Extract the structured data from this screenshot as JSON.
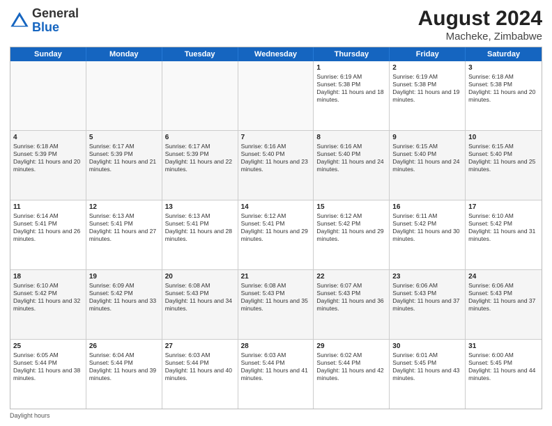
{
  "header": {
    "logo": {
      "general": "General",
      "blue": "Blue"
    },
    "title": "August 2024",
    "location": "Macheke, Zimbabwe"
  },
  "days_of_week": [
    "Sunday",
    "Monday",
    "Tuesday",
    "Wednesday",
    "Thursday",
    "Friday",
    "Saturday"
  ],
  "rows": [
    [
      {
        "day": "",
        "empty": true
      },
      {
        "day": "",
        "empty": true
      },
      {
        "day": "",
        "empty": true
      },
      {
        "day": "",
        "empty": true
      },
      {
        "day": "1",
        "sunrise": "6:19 AM",
        "sunset": "5:38 PM",
        "daylight": "11 hours and 18 minutes."
      },
      {
        "day": "2",
        "sunrise": "6:19 AM",
        "sunset": "5:38 PM",
        "daylight": "11 hours and 19 minutes."
      },
      {
        "day": "3",
        "sunrise": "6:18 AM",
        "sunset": "5:38 PM",
        "daylight": "11 hours and 20 minutes."
      }
    ],
    [
      {
        "day": "4",
        "sunrise": "6:18 AM",
        "sunset": "5:39 PM",
        "daylight": "11 hours and 20 minutes."
      },
      {
        "day": "5",
        "sunrise": "6:17 AM",
        "sunset": "5:39 PM",
        "daylight": "11 hours and 21 minutes."
      },
      {
        "day": "6",
        "sunrise": "6:17 AM",
        "sunset": "5:39 PM",
        "daylight": "11 hours and 22 minutes."
      },
      {
        "day": "7",
        "sunrise": "6:16 AM",
        "sunset": "5:40 PM",
        "daylight": "11 hours and 23 minutes."
      },
      {
        "day": "8",
        "sunrise": "6:16 AM",
        "sunset": "5:40 PM",
        "daylight": "11 hours and 24 minutes."
      },
      {
        "day": "9",
        "sunrise": "6:15 AM",
        "sunset": "5:40 PM",
        "daylight": "11 hours and 24 minutes."
      },
      {
        "day": "10",
        "sunrise": "6:15 AM",
        "sunset": "5:40 PM",
        "daylight": "11 hours and 25 minutes."
      }
    ],
    [
      {
        "day": "11",
        "sunrise": "6:14 AM",
        "sunset": "5:41 PM",
        "daylight": "11 hours and 26 minutes."
      },
      {
        "day": "12",
        "sunrise": "6:13 AM",
        "sunset": "5:41 PM",
        "daylight": "11 hours and 27 minutes."
      },
      {
        "day": "13",
        "sunrise": "6:13 AM",
        "sunset": "5:41 PM",
        "daylight": "11 hours and 28 minutes."
      },
      {
        "day": "14",
        "sunrise": "6:12 AM",
        "sunset": "5:41 PM",
        "daylight": "11 hours and 29 minutes."
      },
      {
        "day": "15",
        "sunrise": "6:12 AM",
        "sunset": "5:42 PM",
        "daylight": "11 hours and 29 minutes."
      },
      {
        "day": "16",
        "sunrise": "6:11 AM",
        "sunset": "5:42 PM",
        "daylight": "11 hours and 30 minutes."
      },
      {
        "day": "17",
        "sunrise": "6:10 AM",
        "sunset": "5:42 PM",
        "daylight": "11 hours and 31 minutes."
      }
    ],
    [
      {
        "day": "18",
        "sunrise": "6:10 AM",
        "sunset": "5:42 PM",
        "daylight": "11 hours and 32 minutes."
      },
      {
        "day": "19",
        "sunrise": "6:09 AM",
        "sunset": "5:42 PM",
        "daylight": "11 hours and 33 minutes."
      },
      {
        "day": "20",
        "sunrise": "6:08 AM",
        "sunset": "5:43 PM",
        "daylight": "11 hours and 34 minutes."
      },
      {
        "day": "21",
        "sunrise": "6:08 AM",
        "sunset": "5:43 PM",
        "daylight": "11 hours and 35 minutes."
      },
      {
        "day": "22",
        "sunrise": "6:07 AM",
        "sunset": "5:43 PM",
        "daylight": "11 hours and 36 minutes."
      },
      {
        "day": "23",
        "sunrise": "6:06 AM",
        "sunset": "5:43 PM",
        "daylight": "11 hours and 37 minutes."
      },
      {
        "day": "24",
        "sunrise": "6:06 AM",
        "sunset": "5:43 PM",
        "daylight": "11 hours and 37 minutes."
      }
    ],
    [
      {
        "day": "25",
        "sunrise": "6:05 AM",
        "sunset": "5:44 PM",
        "daylight": "11 hours and 38 minutes."
      },
      {
        "day": "26",
        "sunrise": "6:04 AM",
        "sunset": "5:44 PM",
        "daylight": "11 hours and 39 minutes."
      },
      {
        "day": "27",
        "sunrise": "6:03 AM",
        "sunset": "5:44 PM",
        "daylight": "11 hours and 40 minutes."
      },
      {
        "day": "28",
        "sunrise": "6:03 AM",
        "sunset": "5:44 PM",
        "daylight": "11 hours and 41 minutes."
      },
      {
        "day": "29",
        "sunrise": "6:02 AM",
        "sunset": "5:44 PM",
        "daylight": "11 hours and 42 minutes."
      },
      {
        "day": "30",
        "sunrise": "6:01 AM",
        "sunset": "5:45 PM",
        "daylight": "11 hours and 43 minutes."
      },
      {
        "day": "31",
        "sunrise": "6:00 AM",
        "sunset": "5:45 PM",
        "daylight": "11 hours and 44 minutes."
      }
    ]
  ],
  "footer": {
    "label": "Daylight hours"
  }
}
